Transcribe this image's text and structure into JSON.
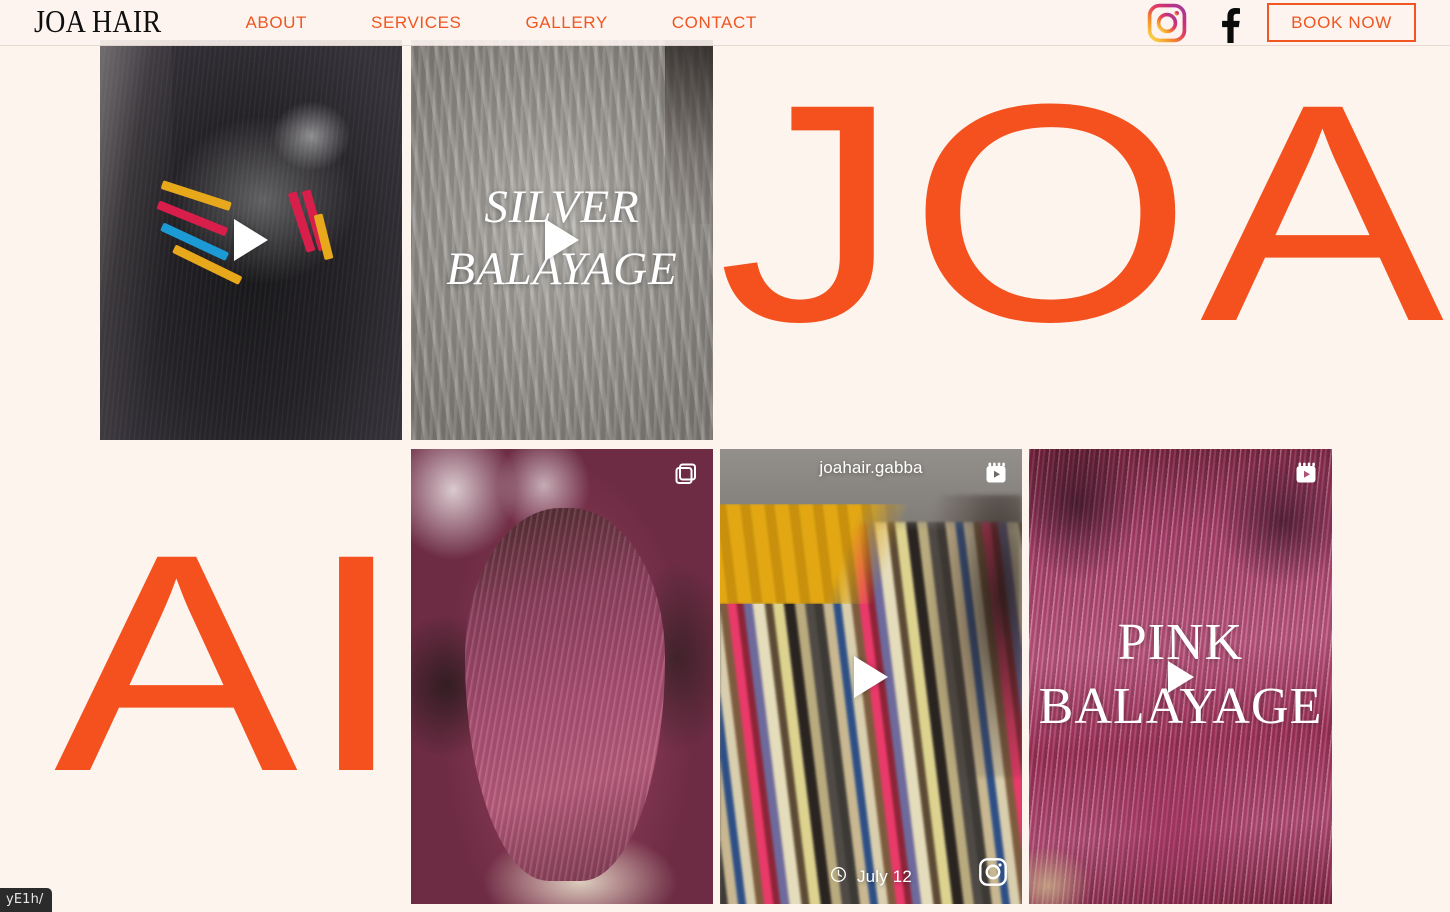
{
  "page": {
    "background_color": "#fdf4ee",
    "accent_color": "#ef5622",
    "logo_color": "#0e0e0e"
  },
  "header": {
    "logo": "JOA HAIR",
    "nav": [
      {
        "label": "ABOUT"
      },
      {
        "label": "SERVICES"
      },
      {
        "label": "GALLERY"
      },
      {
        "label": "CONTACT"
      }
    ],
    "social": [
      {
        "name": "instagram-icon",
        "label": "Instagram"
      },
      {
        "name": "facebook-icon",
        "label": "Facebook"
      }
    ],
    "cta_label": "BOOK NOW"
  },
  "brand_watermark": {
    "top_text": "JOA H",
    "bottom_text": "AIR",
    "color": "#f4511e"
  },
  "feed": {
    "tiles": [
      {
        "id": "tile-dark-hair-clips",
        "media_type": "video",
        "has_play_button": true,
        "overlay_title": "",
        "username": "",
        "date": "",
        "corner_icon": ""
      },
      {
        "id": "tile-silver-balayage",
        "media_type": "video",
        "has_play_button": true,
        "overlay_title_line1": "SILVER",
        "overlay_title_line2": "BALAYAGE",
        "username": "",
        "date": "",
        "corner_icon": ""
      },
      {
        "id": "tile-pink-hair-salon",
        "media_type": "carousel",
        "has_play_button": false,
        "overlay_title": "",
        "username": "",
        "date": "",
        "corner_icon": "carousel-icon"
      },
      {
        "id": "tile-hair-extensions",
        "media_type": "reel",
        "has_play_button": true,
        "overlay_title": "",
        "username": "joahair.gabba",
        "date": "July 12",
        "corner_icon": "reels-icon",
        "bottom_right_icon": "instagram-icon",
        "date_icon": "clock-icon"
      },
      {
        "id": "tile-pink-balayage",
        "media_type": "reel",
        "has_play_button": true,
        "overlay_title_line1": "PINK",
        "overlay_title_line2": "BALAYAGE",
        "username": "",
        "date": "",
        "corner_icon": "reels-icon"
      }
    ]
  },
  "browser": {
    "status_tooltip": "yE1h/"
  }
}
